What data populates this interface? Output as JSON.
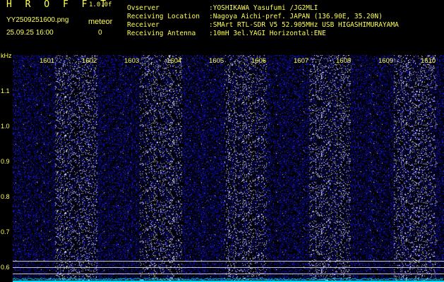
{
  "header": {
    "app_title": "H R O F F T",
    "version": "1.0.0f",
    "file_name": "YY2509251600.png",
    "date_time": "25.09.25 16:00",
    "meteor_label": "meteor",
    "meteor_count": "0"
  },
  "info": [
    {
      "label": "Ovserver",
      "value": ":YOSHIKAWA Yasufumi /JG2MLI"
    },
    {
      "label": "Receiving Location",
      "value": ":Nagoya Aichi-pref. JAPAN (136.90E, 35.20N)"
    },
    {
      "label": "Receiver",
      "value": ":SMArt RTL-SDR V5 52.905MHz USB HIGASHIMURAYAMA"
    },
    {
      "label": "Receiving Antenna",
      "value": ":10mH 3el.YAGI Horizontal:ENE"
    }
  ],
  "axis": {
    "y_unit": "kHz",
    "y_ticks": [
      "1.1",
      "1.0",
      "0.9",
      "0.8",
      "0.7",
      "0.6"
    ],
    "x_ticks": [
      "1601",
      "1602",
      "1603",
      "1604",
      "1605",
      "1606",
      "1607",
      "1608",
      "1609",
      "1610"
    ]
  },
  "colors": {
    "text": "#ffff55",
    "noise": "#1a1aa8",
    "baseline_trace": "#00e5ff"
  }
}
